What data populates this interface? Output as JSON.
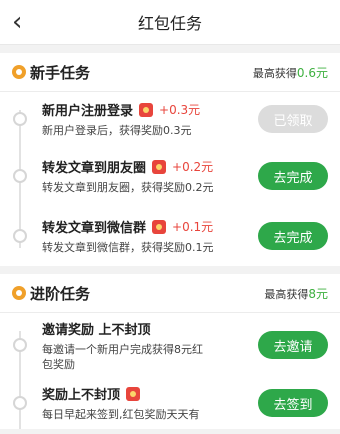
{
  "header": {
    "back_icon": "chevron-left-icon",
    "title": "红包任务"
  },
  "sections": [
    {
      "title": "新手任务",
      "reward_label": "最高获得",
      "reward_value": "0.6元",
      "tasks": [
        {
          "title": "新用户注册登录",
          "bonus": "+0.3元",
          "desc": "新用户登录后，获得奖励0.3元",
          "button": "已领取",
          "disabled": true
        },
        {
          "title": "转发文章到朋友圈",
          "bonus": "+0.2元",
          "desc": "转发文章到朋友圈，获得奖励0.2元",
          "button": "去完成",
          "disabled": false
        },
        {
          "title": "转发文章到微信群",
          "bonus": "+0.1元",
          "desc": "转发文章到微信群，获得奖励0.1元",
          "button": "去完成",
          "disabled": false
        }
      ]
    },
    {
      "title": "进阶任务",
      "reward_label": "最高获得",
      "reward_value": "8元",
      "tasks": [
        {
          "title": "邀请奖励 上不封顶",
          "bonus": "",
          "desc": "每邀请一个新用户完成获得8元红包奖励",
          "button": "去邀请",
          "disabled": false
        },
        {
          "title": "奖励上不封顶",
          "bonus": "",
          "desc": "每日早起来签到,红包奖励天天有",
          "button": "去签到",
          "disabled": false
        }
      ]
    }
  ],
  "colors": {
    "accent": "#2ea84a",
    "bonus": "#e8453c",
    "section_icon": "#f0a02a"
  }
}
